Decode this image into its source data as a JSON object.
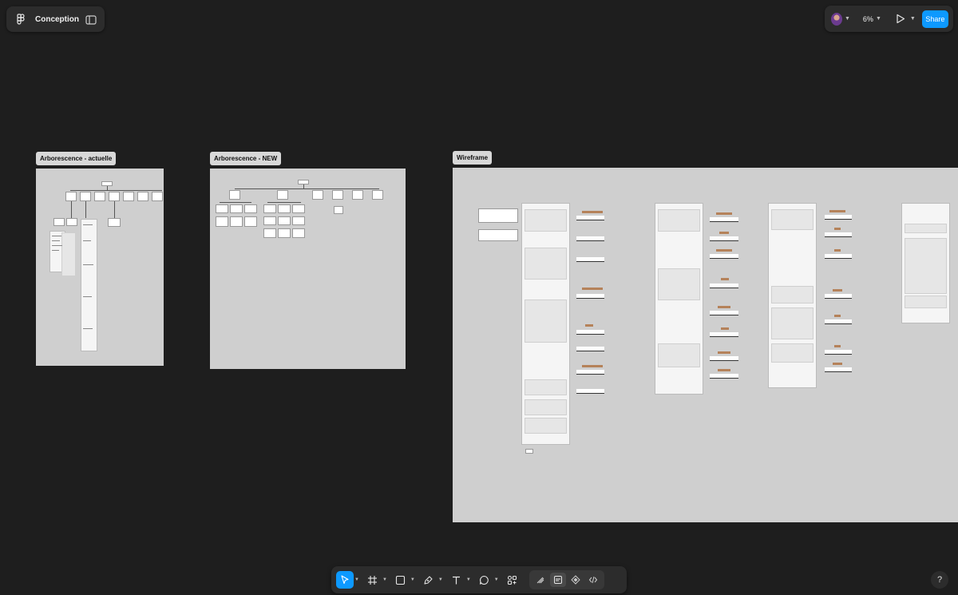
{
  "file": {
    "title": "Conception"
  },
  "toolbar_right": {
    "zoom": "6%",
    "share_label": "Share"
  },
  "frames": {
    "current_tree": "Arborescence - actuelle",
    "new_tree": "Arborescence - NEW",
    "wireframe": "Wireframe"
  },
  "tools": [
    {
      "icon": "move-icon",
      "active": true
    },
    {
      "icon": "frame-icon"
    },
    {
      "icon": "rectangle-icon"
    },
    {
      "icon": "pen-icon"
    },
    {
      "icon": "text-icon"
    },
    {
      "icon": "comment-icon"
    },
    {
      "icon": "actions-icon"
    }
  ],
  "modes": [
    "draw-mode-icon",
    "design-mode-icon",
    "dev-mode-icon",
    "code-icon"
  ],
  "help_label": "?",
  "colors": {
    "canvas": "#1e1e1e",
    "panel": "#2c2c2c",
    "accent": "#0d99ff",
    "frame": "#cfcfcf",
    "tag": "#b5825a"
  }
}
